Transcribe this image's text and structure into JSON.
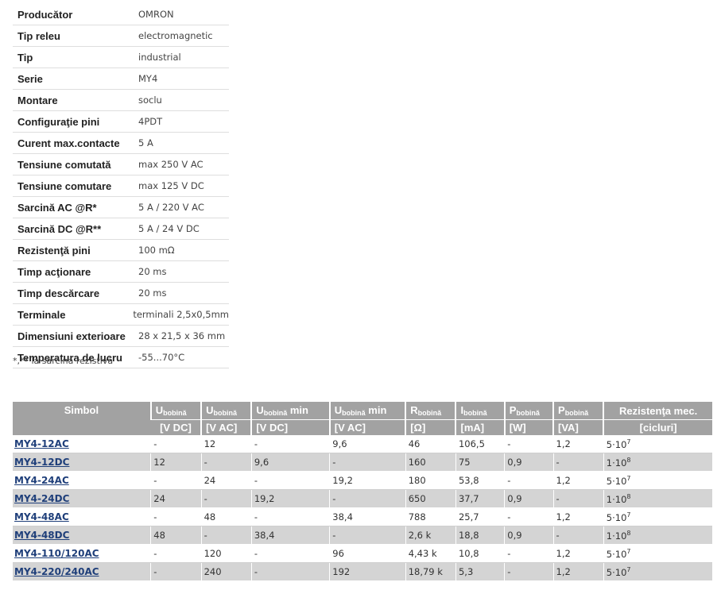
{
  "specs": [
    {
      "label": "Producător",
      "value": "OMRON"
    },
    {
      "label": "Tip releu",
      "value": "electromagnetic"
    },
    {
      "label": "Tip",
      "value": "industrial"
    },
    {
      "label": "Serie",
      "value": "MY4"
    },
    {
      "label": "Montare",
      "value": "soclu"
    },
    {
      "label": "Configuraţie pini",
      "value": "4PDT"
    },
    {
      "label": "Curent max.contacte",
      "value": "5 A"
    },
    {
      "label": "Tensiune comutată",
      "value": "max 250 V AC"
    },
    {
      "label": "Tensiune comutare",
      "value": "max 125 V DC"
    },
    {
      "label": "Sarcină AC @R*",
      "value": "5 A / 220 V AC"
    },
    {
      "label": "Sarcină DC @R**",
      "value": "5 A / 24 V DC"
    },
    {
      "label": "Rezistenţă pini",
      "value": "100 mΩ"
    },
    {
      "label": "Timp acţionare",
      "value": "20 ms"
    },
    {
      "label": "Timp descărcare",
      "value": "20 ms"
    },
    {
      "label": "Terminale",
      "value": "terminali 2,5x0,5mm"
    },
    {
      "label": "Dimensiuni exterioare",
      "value": "28 x 21,5 x 36 mm"
    },
    {
      "label": "Temperatura de lucru",
      "value": "-55...70°C"
    }
  ],
  "spec_note": "*,** la sarcina rezistivă",
  "models_table": {
    "header": {
      "symbol": "Simbol",
      "cols": [
        {
          "main": "U",
          "sub": "bobină",
          "suffix": "",
          "unit": "[V DC]"
        },
        {
          "main": "U",
          "sub": "bobină",
          "suffix": "",
          "unit": "[V AC]"
        },
        {
          "main": "U",
          "sub": "bobină",
          "suffix": " min",
          "unit": "[V DC]"
        },
        {
          "main": "U",
          "sub": "bobină",
          "suffix": " min",
          "unit": "[V AC]"
        },
        {
          "main": "R",
          "sub": "bobină",
          "suffix": "",
          "unit": "[Ω]"
        },
        {
          "main": "I",
          "sub": "bobină",
          "suffix": "",
          "unit": "[mA]"
        },
        {
          "main": "P",
          "sub": "bobină",
          "suffix": "",
          "unit": "[W]"
        },
        {
          "main": "P",
          "sub": "bobină",
          "suffix": "",
          "unit": "[VA]"
        },
        {
          "main": "Rezistenţa mec.",
          "sub": "",
          "suffix": "",
          "unit": "[cicluri]"
        }
      ]
    },
    "rows": [
      {
        "symbol": "MY4-12AC",
        "cells": [
          "-",
          "12",
          "-",
          "9,6",
          "46",
          "106,5",
          "-",
          "1,2"
        ],
        "mech_base": "5·10",
        "mech_exp": "7"
      },
      {
        "symbol": "MY4-12DC",
        "cells": [
          "12",
          "-",
          "9,6",
          "-",
          "160",
          "75",
          "0,9",
          "-"
        ],
        "mech_base": "1·10",
        "mech_exp": "8"
      },
      {
        "symbol": "MY4-24AC",
        "cells": [
          "-",
          "24",
          "-",
          "19,2",
          "180",
          "53,8",
          "-",
          "1,2"
        ],
        "mech_base": "5·10",
        "mech_exp": "7"
      },
      {
        "symbol": "MY4-24DC",
        "cells": [
          "24",
          "-",
          "19,2",
          "-",
          "650",
          "37,7",
          "0,9",
          "-"
        ],
        "mech_base": "1·10",
        "mech_exp": "8"
      },
      {
        "symbol": "MY4-48AC",
        "cells": [
          "-",
          "48",
          "-",
          "38,4",
          "788",
          "25,7",
          "-",
          "1,2"
        ],
        "mech_base": "5·10",
        "mech_exp": "7"
      },
      {
        "symbol": "MY4-48DC",
        "cells": [
          "48",
          "-",
          "38,4",
          "-",
          "2,6 k",
          "18,8",
          "0,9",
          "-"
        ],
        "mech_base": "1·10",
        "mech_exp": "8"
      },
      {
        "symbol": "MY4-110/120AC",
        "cells": [
          "-",
          "120",
          "-",
          "96",
          "4,43 k",
          "10,8",
          "-",
          "1,2"
        ],
        "mech_base": "5·10",
        "mech_exp": "7"
      },
      {
        "symbol": "MY4-220/240AC",
        "cells": [
          "-",
          "240",
          "-",
          "192",
          "18,79 k",
          "5,3",
          "-",
          "1,2"
        ],
        "mech_base": "5·10",
        "mech_exp": "7"
      }
    ]
  }
}
